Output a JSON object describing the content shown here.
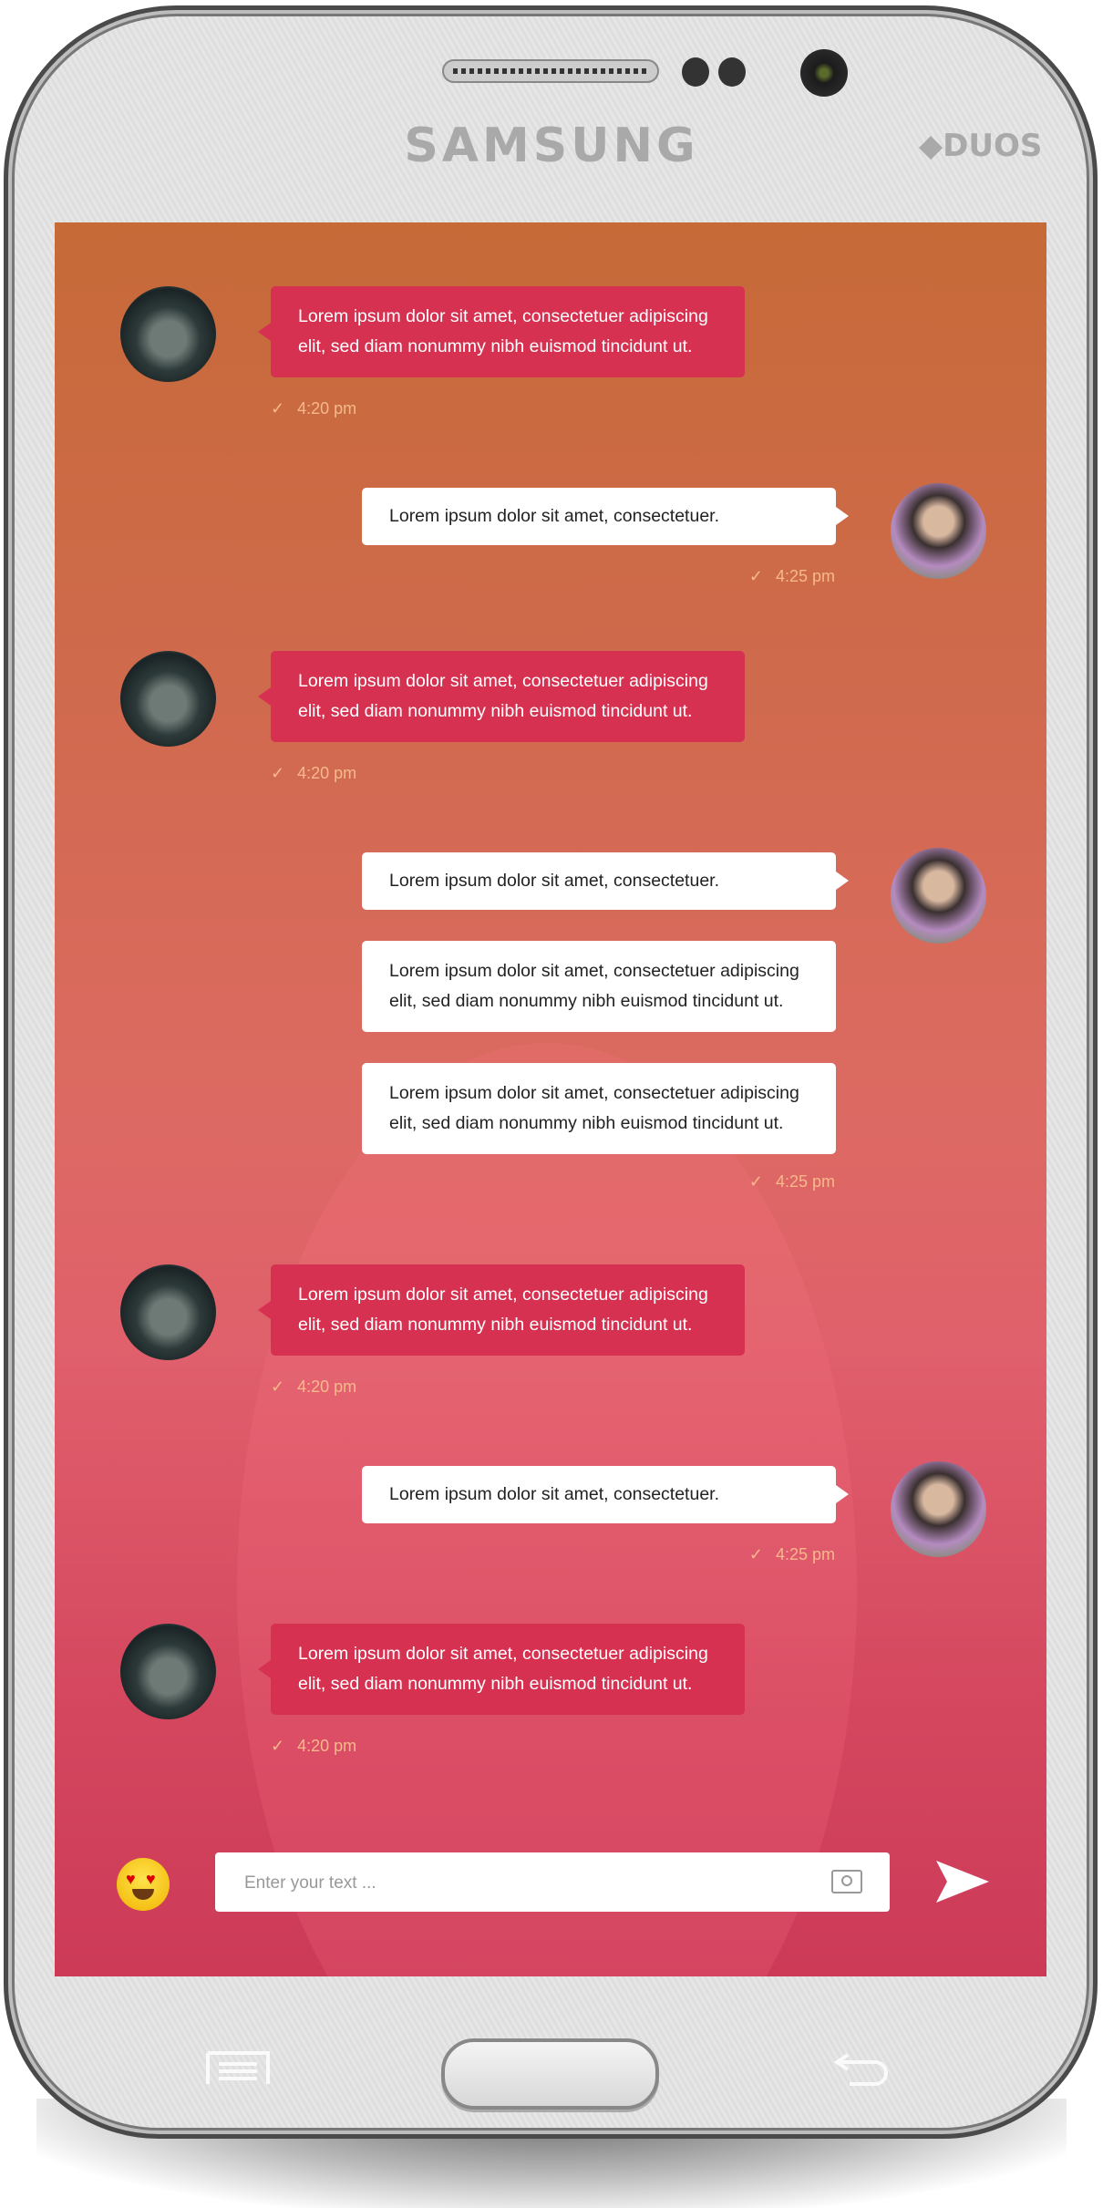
{
  "device": {
    "brand": "SAMSUNG",
    "model_badge": "DUOS"
  },
  "colors": {
    "incoming_bubble": "#d63151",
    "outgoing_bubble": "#ffffff",
    "timestamp": "#f6b98c"
  },
  "messages": [
    {
      "direction": "in",
      "avatar": "boy",
      "bubbles": [
        "Lorem ipsum dolor sit amet, consectetuer adipiscing elit, sed diam nonummy nibh euismod tincidunt ut."
      ],
      "time": "4:20 pm"
    },
    {
      "direction": "out",
      "avatar": "girl",
      "bubbles": [
        "Lorem ipsum dolor sit amet, consectetuer."
      ],
      "time": "4:25 pm"
    },
    {
      "direction": "in",
      "avatar": "boy",
      "bubbles": [
        "Lorem ipsum dolor sit amet, consectetuer adipiscing elit, sed diam nonummy nibh euismod tincidunt ut."
      ],
      "time": "4:20 pm"
    },
    {
      "direction": "out",
      "avatar": "girl",
      "bubbles": [
        "Lorem ipsum dolor sit amet, consectetuer.",
        "Lorem ipsum dolor sit amet, consectetuer adipiscing elit, sed diam nonummy nibh euismod tincidunt ut.",
        "Lorem ipsum dolor sit amet, consectetuer adipiscing elit, sed diam nonummy nibh euismod tincidunt ut."
      ],
      "time": "4:25 pm"
    },
    {
      "direction": "in",
      "avatar": "boy",
      "bubbles": [
        "Lorem ipsum dolor sit amet, consectetuer adipiscing elit, sed diam nonummy nibh euismod tincidunt ut."
      ],
      "time": "4:20 pm"
    },
    {
      "direction": "out",
      "avatar": "girl",
      "bubbles": [
        "Lorem ipsum dolor sit amet, consectetuer."
      ],
      "time": "4:25 pm"
    },
    {
      "direction": "in",
      "avatar": "boy",
      "bubbles": [
        "Lorem ipsum dolor sit amet, consectetuer adipiscing elit, sed diam nonummy nibh euismod tincidunt ut."
      ],
      "time": "4:20 pm"
    }
  ],
  "status_icon": "check-icon",
  "composer": {
    "placeholder": "Enter your text ...",
    "value": "",
    "emoji_icon": "heart-eyes-emoji-icon",
    "attach_icon": "camera-icon",
    "send_icon": "send-icon"
  }
}
